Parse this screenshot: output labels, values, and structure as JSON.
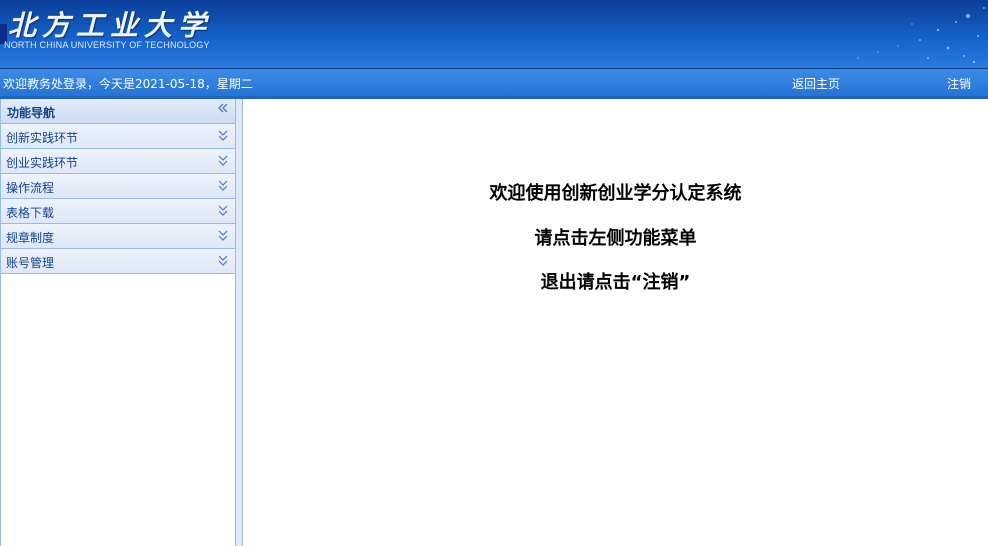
{
  "banner": {
    "logo_cn": "北方工业大学",
    "logo_en": "NORTH CHINA UNIVERSITY OF TECHNOLOGY"
  },
  "statusbar": {
    "welcome_text": "欢迎教务处登录，今天是2021-05-18，星期二",
    "home_label": "返回主页",
    "logout_label": "注销"
  },
  "sidebar": {
    "title": "功能导航",
    "items": [
      {
        "label": "创新实践环节"
      },
      {
        "label": "创业实践环节"
      },
      {
        "label": "操作流程"
      },
      {
        "label": "表格下载"
      },
      {
        "label": "规章制度"
      },
      {
        "label": "账号管理"
      }
    ]
  },
  "main": {
    "line1": "欢迎使用创新创业学分认定系统",
    "line2": "请点击左侧功能菜单",
    "line3": "退出请点击“注销”"
  },
  "icons": {
    "collapse": "double-chevron-left-icon",
    "expand": "double-chevron-down-icon"
  },
  "colors": {
    "banner_dark": "#0a3f9a",
    "banner_light": "#2a7be0",
    "statusbar": "#2574d6",
    "nav_text": "#15428b",
    "panel_border": "#99bbe8"
  }
}
